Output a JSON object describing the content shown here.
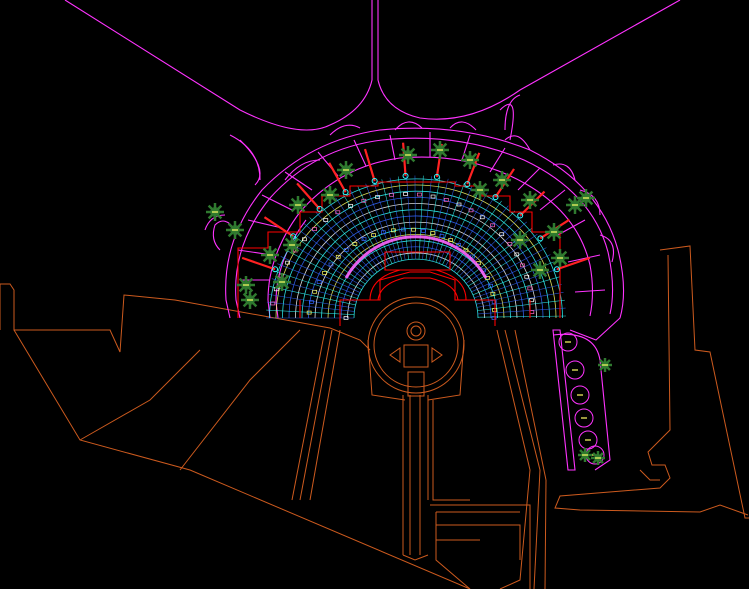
{
  "drawing": {
    "background": "#000000",
    "colors": {
      "roads": "#ff33ff",
      "site": "#cc5a1e",
      "walls": "#ff0000",
      "grid_cyan": "#33ffff",
      "grid_blue": "#3366ff",
      "grid_white": "#ffffff",
      "grid_yellow": "#ffff66",
      "trees": "#2f7a2f",
      "tree_marks": "#ffff66",
      "arrows": "#ff2222"
    },
    "icons": [
      "tree-icon",
      "arrow-icon",
      "parking-circle-icon"
    ],
    "tree_count_arc": 22,
    "parking_circles": 6
  }
}
